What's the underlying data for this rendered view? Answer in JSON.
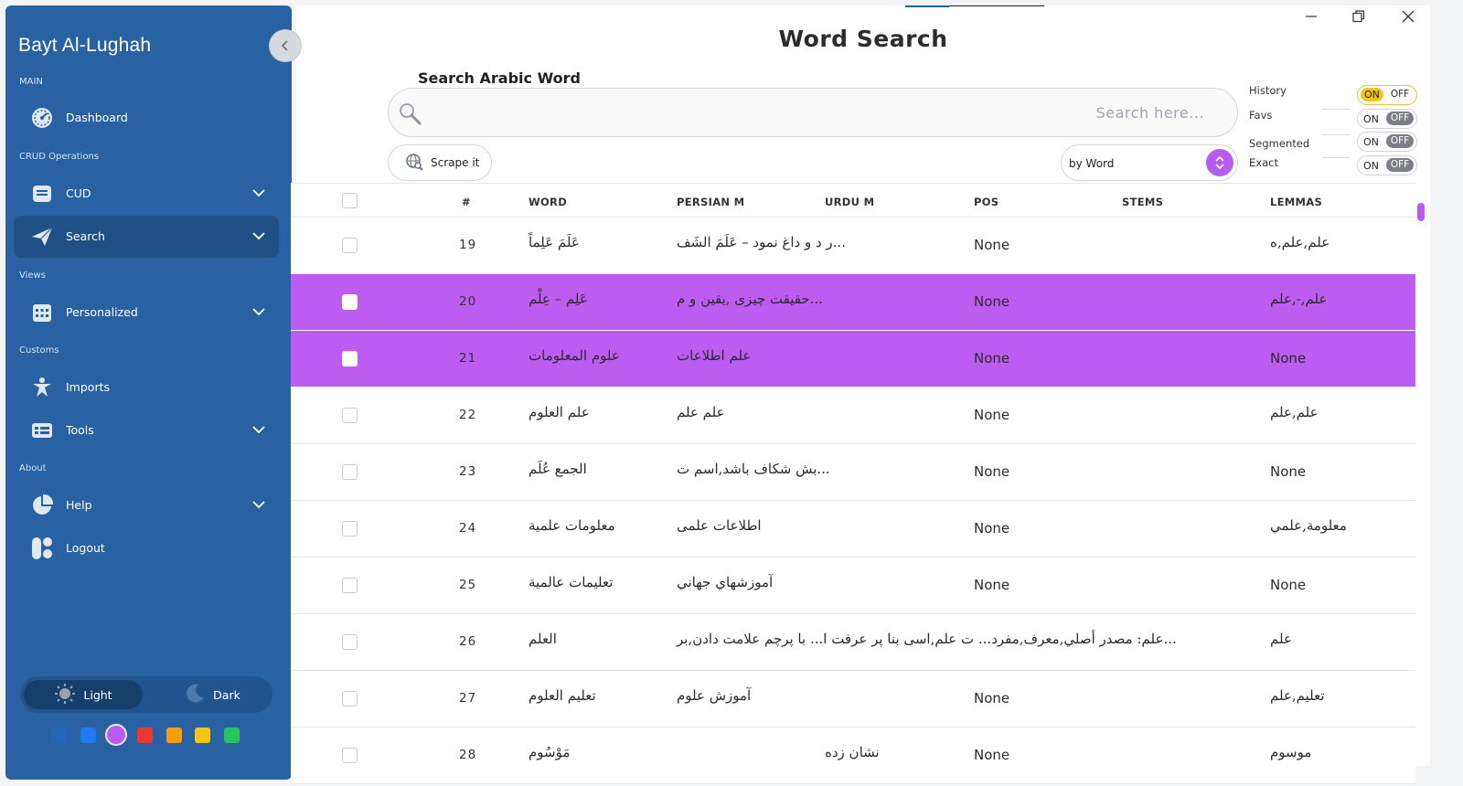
{
  "app_title": "Bayt Al-Lughah",
  "sidebar": {
    "sections": [
      "MAIN",
      "CRUD Operations",
      "Views",
      "Customs",
      "About"
    ],
    "items": [
      {
        "label": "Dashboard",
        "icon": "gauge-icon"
      },
      {
        "label": "CUD",
        "icon": "database-icon"
      },
      {
        "label": "Search",
        "icon": "paper-plane-icon",
        "active": true
      },
      {
        "label": "Personalized",
        "icon": "calendar-grid-icon"
      },
      {
        "label": "Imports",
        "icon": "person-icon"
      },
      {
        "label": "Tools",
        "icon": "list-card-icon"
      },
      {
        "label": "Help",
        "icon": "pie-chart-icon"
      },
      {
        "label": "Logout",
        "icon": "logout-icon"
      }
    ],
    "theme": {
      "light_label": "Light",
      "dark_label": "Dark"
    },
    "accent_colors": [
      "#2466b8",
      "#1e7bf2",
      "#b85cf0",
      "#ea3b2e",
      "#f59e0b",
      "#f5c518",
      "#22c55e"
    ]
  },
  "page": {
    "title": "Word Search",
    "search_label": "Search Arabic Word",
    "search_placeholder": "Search here...",
    "search_value": "",
    "scrape_label": "Scrape it",
    "search_by": "by Word"
  },
  "options": [
    {
      "label": "History",
      "on": "ON",
      "off": "OFF",
      "state": "on"
    },
    {
      "label": "Favs",
      "on": "ON",
      "off": "OFF",
      "state": "off"
    },
    {
      "label": "Segmented",
      "on": "ON",
      "off": "OFF",
      "state": "off"
    },
    {
      "label": "Exact",
      "on": "ON",
      "off": "OFF",
      "state": "off"
    }
  ],
  "table": {
    "columns": [
      "#",
      "WORD",
      "PERSIAN M",
      "URDU M",
      "POS",
      "STEMS",
      "LEMMAS"
    ],
    "rows": [
      {
        "n": "19",
        "word": "عَلَمَ عَلِماً",
        "persian": "...ر د و داغ نمود – عَلَمَ الشَف",
        "urdu": "",
        "pos": "None",
        "stems": "",
        "lemmas": "علم,علم,ه",
        "hl": false
      },
      {
        "n": "20",
        "word": "عَلِم – عِلْم",
        "persian": "...حقيقت چيزى ,يقين و م",
        "urdu": "",
        "pos": "None",
        "stems": "",
        "lemmas": "علم,-,علم",
        "hl": true
      },
      {
        "n": "21",
        "word": "علوم المعلومات",
        "persian": "علم اطلاعات",
        "urdu": "",
        "pos": "None",
        "stems": "",
        "lemmas": "None",
        "hl": true
      },
      {
        "n": "22",
        "word": "علم العلوم",
        "persian": "علم علم",
        "urdu": "",
        "pos": "None",
        "stems": "",
        "lemmas": "علم,علم",
        "hl": false
      },
      {
        "n": "23",
        "word": "الجمع عُلَم",
        "persian": "...بش شكاف باشد,اسم ت",
        "urdu": "",
        "pos": "None",
        "stems": "",
        "lemmas": "None",
        "hl": false
      },
      {
        "n": "24",
        "word": "معلومات علمية",
        "persian": "اطلاعات علمى",
        "urdu": "",
        "pos": "None",
        "stems": "",
        "lemmas": "معلومة,علمي",
        "hl": false
      },
      {
        "n": "25",
        "word": "تعليمات عالمية",
        "persian": "آموزشهاي جهاني",
        "urdu": "",
        "pos": "None",
        "stems": "",
        "lemmas": "None",
        "hl": false
      },
      {
        "n": "26",
        "word": "العلم",
        "persian": "...علم: مصدر أصلي,معرف,مفرد... ت علم,اسى بنا پر عرفت ا... با پرچم علامت دادن,بر",
        "urdu": "",
        "pos": "",
        "stems": "",
        "lemmas": "علم",
        "hl": false
      },
      {
        "n": "27",
        "word": "تعليم العلوم",
        "persian": "آموزش علوم",
        "urdu": "",
        "pos": "None",
        "stems": "",
        "lemmas": "تعليم,علم",
        "hl": false
      },
      {
        "n": "28",
        "word": "مَوْسُوم",
        "persian": "",
        "urdu": "نشان زده",
        "pos": "None",
        "stems": "",
        "lemmas": "موسوم",
        "hl": false
      }
    ]
  }
}
